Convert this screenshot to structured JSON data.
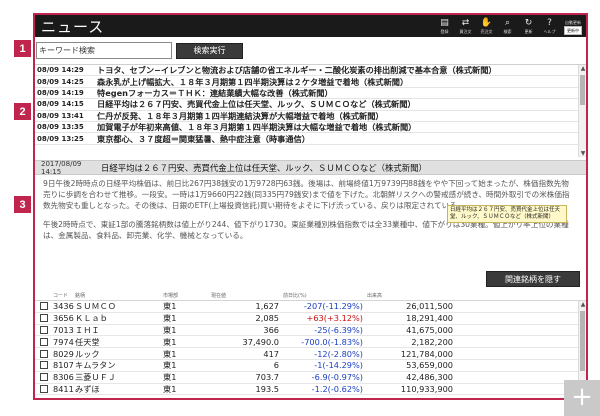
{
  "app": {
    "title": "ニュース",
    "toolbar": [
      {
        "name": "register",
        "label": "登録",
        "icon": "doc-icon",
        "glyph": "▤"
      },
      {
        "name": "buy-sell",
        "label": "買注文",
        "icon": "order-icon",
        "glyph": "⇄"
      },
      {
        "name": "sell",
        "label": "売注文",
        "icon": "sell-icon",
        "glyph": "✋"
      },
      {
        "name": "search",
        "label": "検索",
        "icon": "search-icon",
        "glyph": "⌕"
      },
      {
        "name": "refresh",
        "label": "更新",
        "icon": "refresh-icon",
        "glyph": "↻"
      },
      {
        "name": "help",
        "label": "ヘルプ",
        "icon": "help-icon",
        "glyph": "?"
      }
    ],
    "auto_update": {
      "label": "自動更新",
      "state": "更新中"
    }
  },
  "search": {
    "value": "キーワード検索",
    "button": "検索実行"
  },
  "news": [
    {
      "time": "08/09 14:29",
      "headline": "トヨタ、セブン−イレブンと物流および店舗の省エネルギー・二酸化炭素の排出削減で基本合意（株式新聞）"
    },
    {
      "time": "08/09 14:25",
      "headline": "森永乳が上げ幅拡大、１８年３月期第１四半期決算は２ケタ増益で着地（株式新聞）"
    },
    {
      "time": "08/09 14:19",
      "headline": "特egenフォーカス＝ＴＨＫ：連結業績大幅な改善（株式新聞）"
    },
    {
      "time": "08/09 14:15",
      "headline": "日経平均は２６７円安、売買代金上位は任天堂、ルック、ＳＵＭＣＯなど（株式新聞）"
    },
    {
      "time": "08/09 13:41",
      "headline": "仁丹が反発、１８年３月期第１四半期連結決算が大幅増益で着地（株式新聞）"
    },
    {
      "time": "08/09 13:35",
      "headline": "加賀電子が年初来高値、１８年３月期第１四半期決算は大幅な増益で着地（株式新聞）"
    },
    {
      "time": "08/09 13:25",
      "headline": "東京都心、３７度超＝関東猛暑、熱中症注意（時事通信）"
    }
  ],
  "article": {
    "date": "2017/08/09 14:15",
    "title": "日経平均は２６７円安、売買代金上位は任天堂、ルック、ＳＵＭＣＯなど（株式新聞）",
    "paragraphs": [
      "9日午後2時時点の日経平均株価は、前日比267円38銭安の1万9728円63銭。後場は、前場終値1万9739円88銭をやや下回って始まったが、株価指数先物売りに歩調を合わせて推移。一段安。一時は1万9660円22銭(同335円79銭安)まで値を下げた。北朝鮮リスクへの警戒感が続き、時間外取引での米株価指数先物安も重しとなった。その後は、日銀のETF(上場投資信託)買い期待をよそに下げ渋っている、戻りは限定されている。",
      "午後2時時点で、東証1部の騰落銘柄数は値上がり244、値下がり1730。東証業種別株価指数では全33業種中、値下がりは30業種。値上がり率上位の業種は、金属製品、食料品、卸売業、化学、機械となっている。"
    ],
    "tooltip": "日経平均は２６７円安、売買代金上位は任天堂、ルック、ＳＵＭＣＯなど（株式新聞）"
  },
  "stocks": {
    "hide_button": "関連銘柄を隠す",
    "columns": [
      "コード",
      "銘柄",
      "市場部",
      "現在値",
      "前日比(%)",
      "出来高"
    ],
    "rows": [
      {
        "code": "3436",
        "name": "ＳＵＭＣＯ",
        "market": "東1",
        "price": "1,627",
        "change": "-207(-11.29%)",
        "dir": "neg",
        "volume": "26,011,500"
      },
      {
        "code": "3656",
        "name": "ＫＬａｂ",
        "market": "東1",
        "price": "2,085",
        "change": "+63(+3.12%)",
        "dir": "pos",
        "volume": "18,291,400"
      },
      {
        "code": "7013",
        "name": "ＩＨＩ",
        "market": "東1",
        "price": "366",
        "change": "-25(-6.39%)",
        "dir": "neg",
        "volume": "41,675,000"
      },
      {
        "code": "7974",
        "name": "任天堂",
        "market": "東1",
        "price": "37,490.0",
        "change": "-700.0(-1.83%)",
        "dir": "neg",
        "volume": "2,182,200"
      },
      {
        "code": "8029",
        "name": "ルック",
        "market": "東1",
        "price": "417",
        "change": "-12(-2.80%)",
        "dir": "neg",
        "volume": "121,784,000"
      },
      {
        "code": "8107",
        "name": "キムラタン",
        "market": "東1",
        "price": "6",
        "change": "-1(-14.29%)",
        "dir": "neg",
        "volume": "53,659,000"
      },
      {
        "code": "8306",
        "name": "三菱ＵＦＪ",
        "market": "東1",
        "price": "703.7",
        "change": "-6.9(-0.97%)",
        "dir": "neg",
        "volume": "42,486,300"
      },
      {
        "code": "8411",
        "name": "みずほ",
        "market": "東1",
        "price": "193.5",
        "change": "-1.2(-0.62%)",
        "dir": "neg",
        "volume": "110,933,900"
      }
    ]
  },
  "badges": [
    "1",
    "2",
    "3"
  ],
  "corner": "+"
}
